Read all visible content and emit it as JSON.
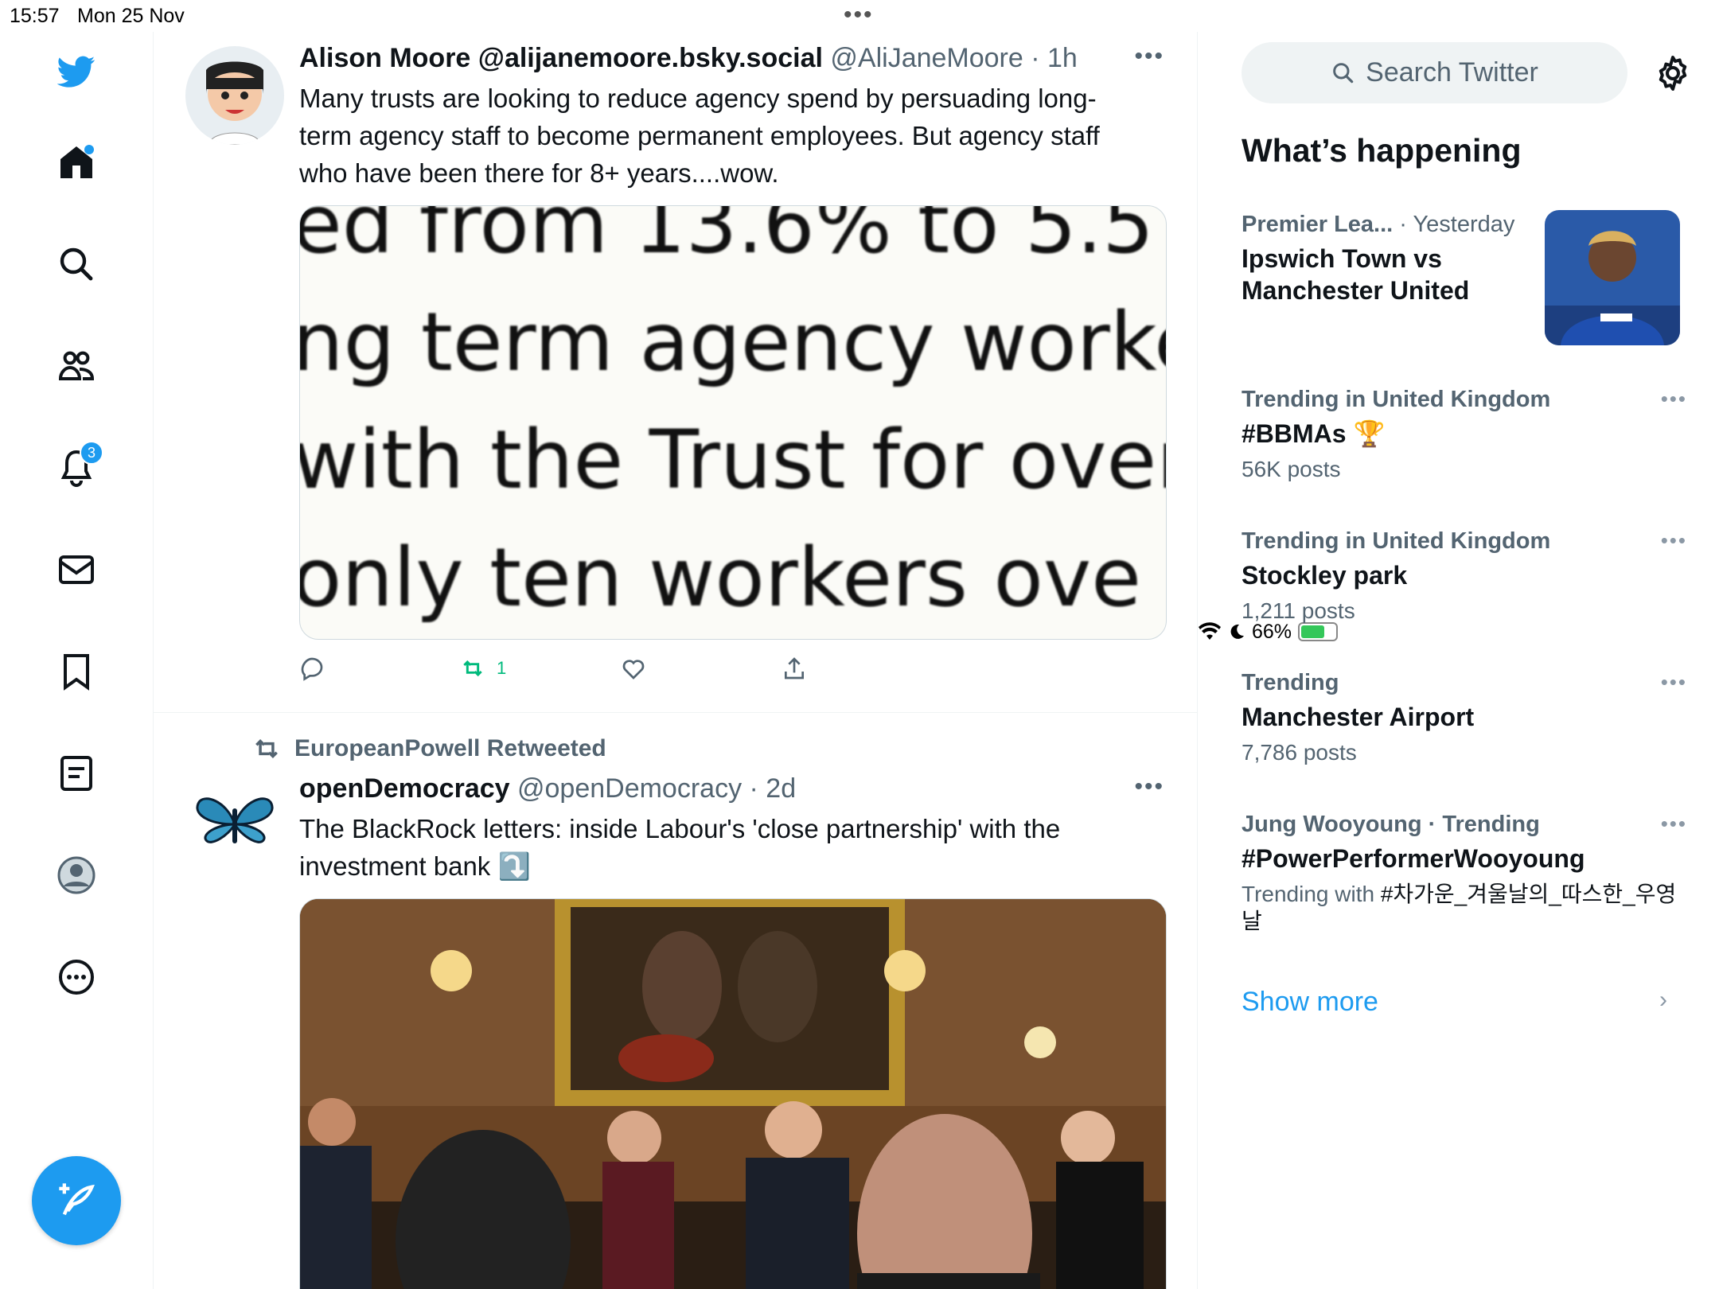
{
  "status_bar": {
    "time": "15:57",
    "date": "Mon 25 Nov",
    "battery": "66%",
    "battery_level": 0.66
  },
  "sidebar": {
    "notifications_badge": "3",
    "accent": "#1d9bf0"
  },
  "tweets": [
    {
      "name": "Alison Moore @alijanemoore.bsky.social",
      "handle": "@AliJaneMoore",
      "time": "· 1h",
      "text": "Many trusts are looking  to reduce agency spend by persuading long-term agency staff to become permanent employees. But agency staff who have been there for 8+ years....wow.",
      "media_lines": [
        "ed from 13.6% to 5.5",
        "ng term agency worke",
        "with the Trust for over",
        "only ten workers ove"
      ],
      "retweets": "1"
    },
    {
      "retweeted_by": "EuropeanPowell Retweeted",
      "name": "openDemocracy",
      "handle": "@openDemocracy",
      "time": "· 2d",
      "text": "The BlackRock letters: inside Labour's 'close partnership' with the investment bank ⤵️"
    }
  ],
  "right": {
    "search_placeholder": "Search Twitter",
    "whats_happening": "What’s happening",
    "trends": [
      {
        "meta": "Premier Lea...",
        "meta_extra": "· Yesterday",
        "title": "Ipswich Town vs Manchester United"
      },
      {
        "meta": "Trending in United Kingdom",
        "title": "#BBMAs 🏆",
        "count": "56K posts"
      },
      {
        "meta": "Trending in United Kingdom",
        "title": "Stockley park",
        "count": "1,211 posts"
      },
      {
        "meta": "Trending",
        "title": "Manchester Airport",
        "count": "7,786 posts"
      },
      {
        "meta": "Jung Wooyoung · Trending",
        "title": "#PowerPerformerWooyoung",
        "count_prefix": "Trending with ",
        "count": "#차가운_겨울날의_따스한_우영날"
      }
    ],
    "show_more": "Show more"
  }
}
